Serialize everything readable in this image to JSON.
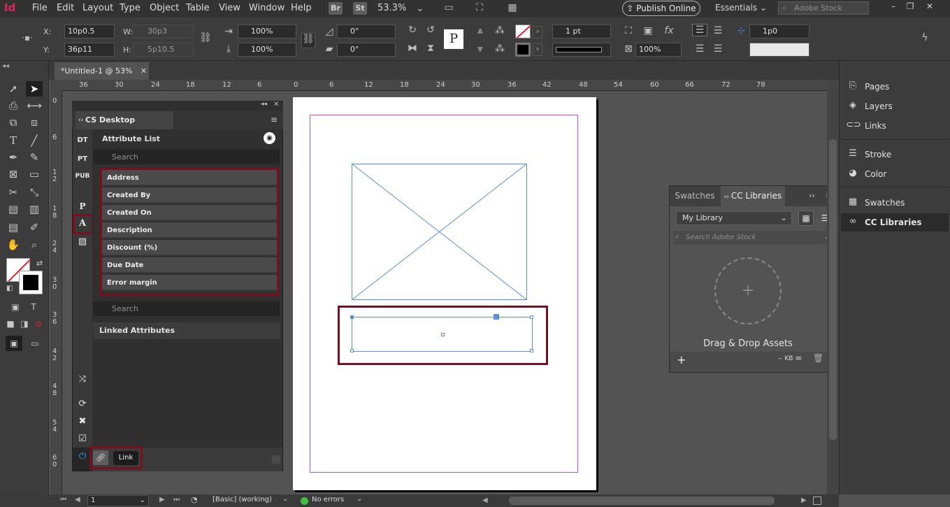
{
  "menubar": {
    "logo": "Id",
    "items": [
      "File",
      "Edit",
      "Layout",
      "Type",
      "Object",
      "Table",
      "View",
      "Window",
      "Help"
    ],
    "bridge": "Br",
    "stock": "St",
    "zoom": "53.3%",
    "publish_label": "Publish Online",
    "workspace": "Essentials",
    "search_placeholder": "Adobe Stock"
  },
  "control": {
    "x_label": "X:",
    "x_value": "10p0.5",
    "y_label": "Y:",
    "y_value": "36p11",
    "w_label": "W:",
    "w_value": "30p3",
    "h_label": "H:",
    "h_value": "5p10.5",
    "scale_x": "100%",
    "scale_y": "100%",
    "rotate": "0°",
    "shear": "0°",
    "stroke_weight": "1 pt",
    "opacity": "100%",
    "spacing": "1p0"
  },
  "document_tab": {
    "title": "*Untitled-1 @ 53%"
  },
  "ruler_h": [
    "36",
    "30",
    "24",
    "18",
    "12",
    "6",
    "0",
    "6",
    "12",
    "18",
    "24",
    "30",
    "36",
    "42",
    "48",
    "54",
    "60",
    "66",
    "72",
    "78"
  ],
  "ruler_v": [
    "0",
    "6",
    "1\n2",
    "1\n8",
    "2\n4",
    "3\n0",
    "3\n6",
    "4\n2",
    "4\n8",
    "5\n4",
    "6\n0"
  ],
  "cs_panel": {
    "title": "CS Desktop Publisher",
    "side_tabs": [
      "DT",
      "PT",
      "PUB",
      "P",
      "A"
    ],
    "attribute_list_title": "Attribute List",
    "search_placeholder": "Search",
    "attributes": [
      "Address",
      "Created By",
      "Created On",
      "Description",
      "Discount (%)",
      "Due Date",
      "Error margin"
    ],
    "search2_placeholder": "Search",
    "linked_attributes_title": "Linked Attributes",
    "link_tooltip": "Link"
  },
  "cc_panel": {
    "tab_swatches": "Swatches",
    "tab_cc": "CC Libraries",
    "library": "My Library",
    "search_placeholder": "Search Adobe Stock",
    "drag_text": "Drag & Drop Assets",
    "footer_size": "-- KB"
  },
  "right_dock": {
    "items": [
      "Pages",
      "Layers",
      "Links",
      "Stroke",
      "Color",
      "Swatches",
      "CC Libraries"
    ]
  },
  "status": {
    "page": "1",
    "profile": "[Basic] (working)",
    "errors": "No errors"
  },
  "colors": {
    "highlight": "#7c0f1f",
    "frame": "#5b8fd9",
    "margin": "#c853c8",
    "status_ok": "#3fbf3f"
  }
}
